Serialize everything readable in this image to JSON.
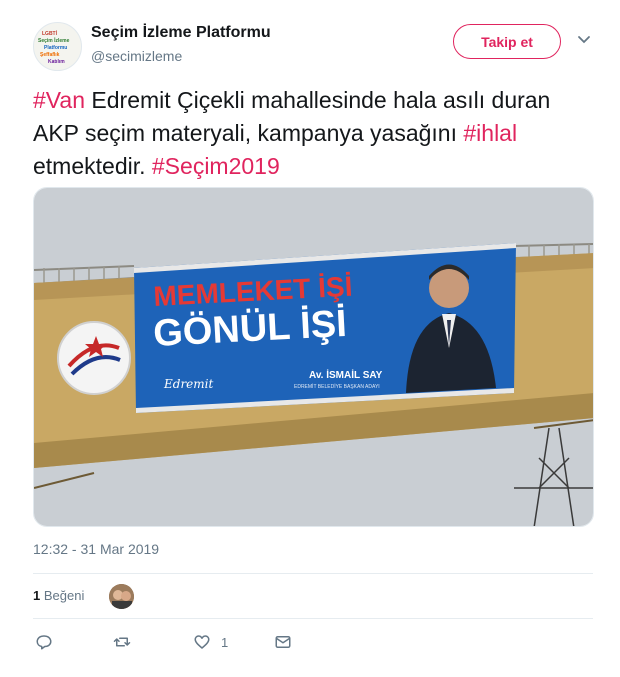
{
  "tweet": {
    "author": {
      "display_name": "Seçim İzleme Platformu",
      "handle": "@secimizleme"
    },
    "follow_label": "Takip et",
    "text_segments": [
      {
        "text": "#Van",
        "type": "hashtag"
      },
      {
        "text": " Edremit Çiçekli mahallesinde hala asılı duran AKP seçim materyali, kampanya yasağını ",
        "type": "text"
      },
      {
        "text": "#ihlal",
        "type": "hashtag"
      },
      {
        "text": " etmektedir. ",
        "type": "text"
      },
      {
        "text": "#Seçim2019",
        "type": "hashtag"
      }
    ],
    "media": {
      "billboard_line1": "MEMLEKET İŞİ",
      "billboard_line2": "GÖNÜL İŞİ",
      "billboard_name": "Av. İSMAİL SAY",
      "billboard_subtitle": "EDREMİT BELEDİYE BAŞKAN ADAYI",
      "billboard_logo": "Edremit"
    },
    "timestamp": "12:32 - 31 Mar 2019",
    "likes": {
      "count": "1",
      "label": "Beğeni"
    },
    "actions": {
      "reply_count": "",
      "retweet_count": "",
      "like_count": "1",
      "dm_count": ""
    }
  },
  "colors": {
    "accent": "#e0245e",
    "secondary_text": "#657786",
    "divider": "#e6ecf0"
  },
  "icons": [
    "reply-icon",
    "retweet-icon",
    "heart-icon",
    "direct-message-icon",
    "chevron-down-icon"
  ]
}
